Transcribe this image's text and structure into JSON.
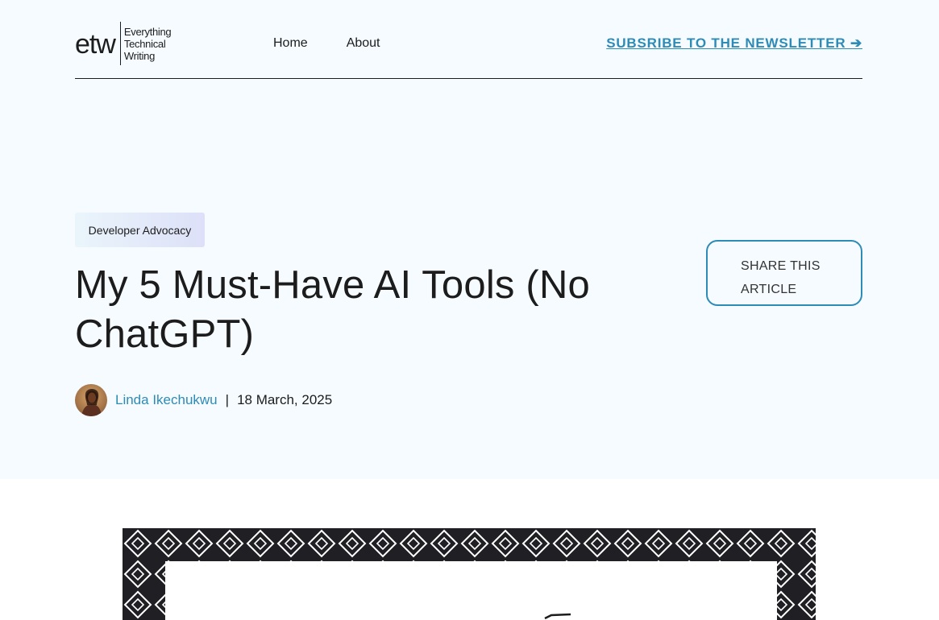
{
  "header": {
    "logo": {
      "mark": "etw",
      "words": [
        "Everything",
        "Technical",
        "Writing"
      ]
    },
    "nav": [
      {
        "label": "Home"
      },
      {
        "label": "About"
      }
    ],
    "newsletter_label": "SUBSRIBE TO THE NEWSLETTER ➔"
  },
  "article": {
    "category": "Developer Advocacy",
    "title": "My 5 Must-Have AI Tools (No ChatGPT)",
    "author": "Linda Ikechukwu",
    "separator": "|",
    "date": "18 March, 2025",
    "share_label": "SHARE THIS ARTICLE"
  },
  "colors": {
    "accent": "#2e8bb5",
    "hero_bg": "#f5fbfe",
    "text": "#1c1c1c"
  }
}
